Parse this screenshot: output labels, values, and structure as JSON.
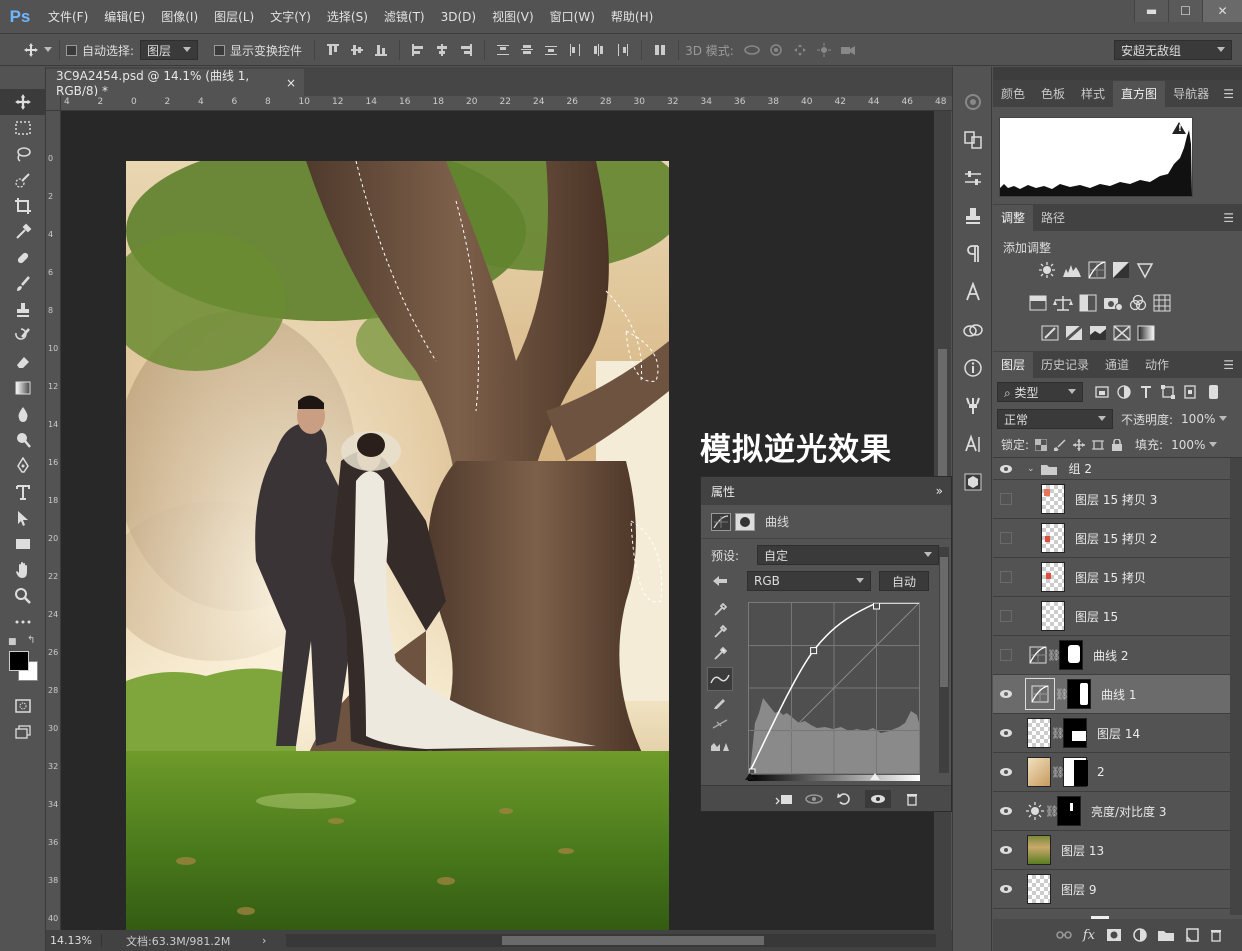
{
  "app": {
    "logo": "Ps",
    "menus": [
      "文件(F)",
      "编辑(E)",
      "图像(I)",
      "图层(L)",
      "文字(Y)",
      "选择(S)",
      "滤镜(T)",
      "3D(D)",
      "视图(V)",
      "窗口(W)",
      "帮助(H)"
    ],
    "window_controls": {
      "minimize": "▬",
      "restore": "☐",
      "close": "✕"
    }
  },
  "options_bar": {
    "auto_select_label": "自动选择:",
    "auto_select_value": "图层",
    "show_transform_label": "显示变换控件",
    "mode3d_label": "3D 模式:",
    "workspace": "安超无敌组"
  },
  "document": {
    "tab_title": "3C9A2454.psd @ 14.1% (曲线 1, RGB/8) *",
    "close_glyph": "×",
    "overlay_caption": "模拟逆光效果",
    "ruler_labels": [
      "4",
      "2",
      "0",
      "2",
      "4",
      "6",
      "8",
      "10",
      "12",
      "14",
      "16",
      "18",
      "20",
      "22",
      "24",
      "26",
      "28",
      "30",
      "32",
      "34",
      "36",
      "38",
      "40",
      "42",
      "44",
      "46",
      "48"
    ],
    "ruler_v_labels": [
      "0",
      "2",
      "4",
      "6",
      "8",
      "10",
      "12",
      "14",
      "16",
      "18",
      "20",
      "22",
      "24",
      "26",
      "28",
      "30",
      "32",
      "34",
      "36",
      "38",
      "40"
    ],
    "zoom": "14.13%",
    "doc_info": "文档:63.3M/981.2M"
  },
  "properties": {
    "title": "属性",
    "expand_glyph": "»",
    "adjustment_name": "曲线",
    "preset_label": "预设:",
    "preset_value": "自定",
    "channel": "RGB",
    "auto_button": "自动",
    "curve_points": [
      [
        0,
        0
      ],
      [
        0.38,
        0.72
      ],
      [
        0.75,
        1.0
      ],
      [
        1.0,
        1.0
      ]
    ]
  },
  "right_panels": {
    "top_tabs": [
      "颜色",
      "色板",
      "样式",
      "直方图",
      "导航器"
    ],
    "top_active": 3,
    "histogram_warning": "!",
    "adjust_tabs": [
      "调整",
      "路径"
    ],
    "adjust_active": 0,
    "add_adjustment": "添加调整",
    "layers_tabs": [
      "图层",
      "历史记录",
      "通道",
      "动作"
    ],
    "layers_active": 0,
    "filter_kind": "类型",
    "blend_mode": "正常",
    "opacity_label": "不透明度:",
    "opacity_value": "100%",
    "lock_label": "锁定:",
    "fill_label": "填充:",
    "fill_value": "100%",
    "layers": [
      {
        "name": "组 2",
        "type": "group",
        "visible": true
      },
      {
        "name": "图层 15 拷贝 3",
        "type": "pixel",
        "visible": false
      },
      {
        "name": "图层 15 拷贝 2",
        "type": "pixel",
        "visible": false
      },
      {
        "name": "图层 15 拷贝",
        "type": "pixel",
        "visible": false
      },
      {
        "name": "图层 15",
        "type": "pixel",
        "visible": false
      },
      {
        "name": "曲线 2",
        "type": "curves",
        "visible": false
      },
      {
        "name": "曲线 1",
        "type": "curves",
        "visible": true,
        "selected": true
      },
      {
        "name": "图层 14",
        "type": "pixel-mask",
        "visible": true
      },
      {
        "name": "2",
        "type": "photo-mask",
        "visible": true
      },
      {
        "name": "亮度/对比度 3",
        "type": "brightness",
        "visible": true
      },
      {
        "name": "图层 13",
        "type": "photo",
        "visible": true
      },
      {
        "name": "图层 9",
        "type": "pixel",
        "visible": true
      }
    ],
    "footer_fx": "fx"
  },
  "icons": {
    "move": "move-icon",
    "eye": "eye-icon",
    "link": "link-icon"
  }
}
